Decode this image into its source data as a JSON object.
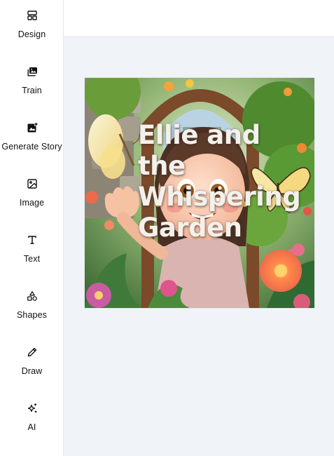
{
  "sidebar": {
    "items": [
      {
        "label": "Design",
        "icon": "layout-icon"
      },
      {
        "label": "Train",
        "icon": "images-icon"
      },
      {
        "label": "Generate Story",
        "icon": "image-plus-icon"
      },
      {
        "label": "Image",
        "icon": "image-icon"
      },
      {
        "label": "Text",
        "icon": "text-icon"
      },
      {
        "label": "Shapes",
        "icon": "shapes-icon"
      },
      {
        "label": "Draw",
        "icon": "pencil-icon"
      },
      {
        "label": "AI",
        "icon": "sparkles-icon"
      }
    ]
  },
  "canvas": {
    "title_text": "Ellie and\nthe\nWhispering\nGarden"
  },
  "colors": {
    "workspace_bg": "#f0f3f8",
    "sidebar_border": "#e5e7eb",
    "title_text": "#f4f1ec"
  }
}
